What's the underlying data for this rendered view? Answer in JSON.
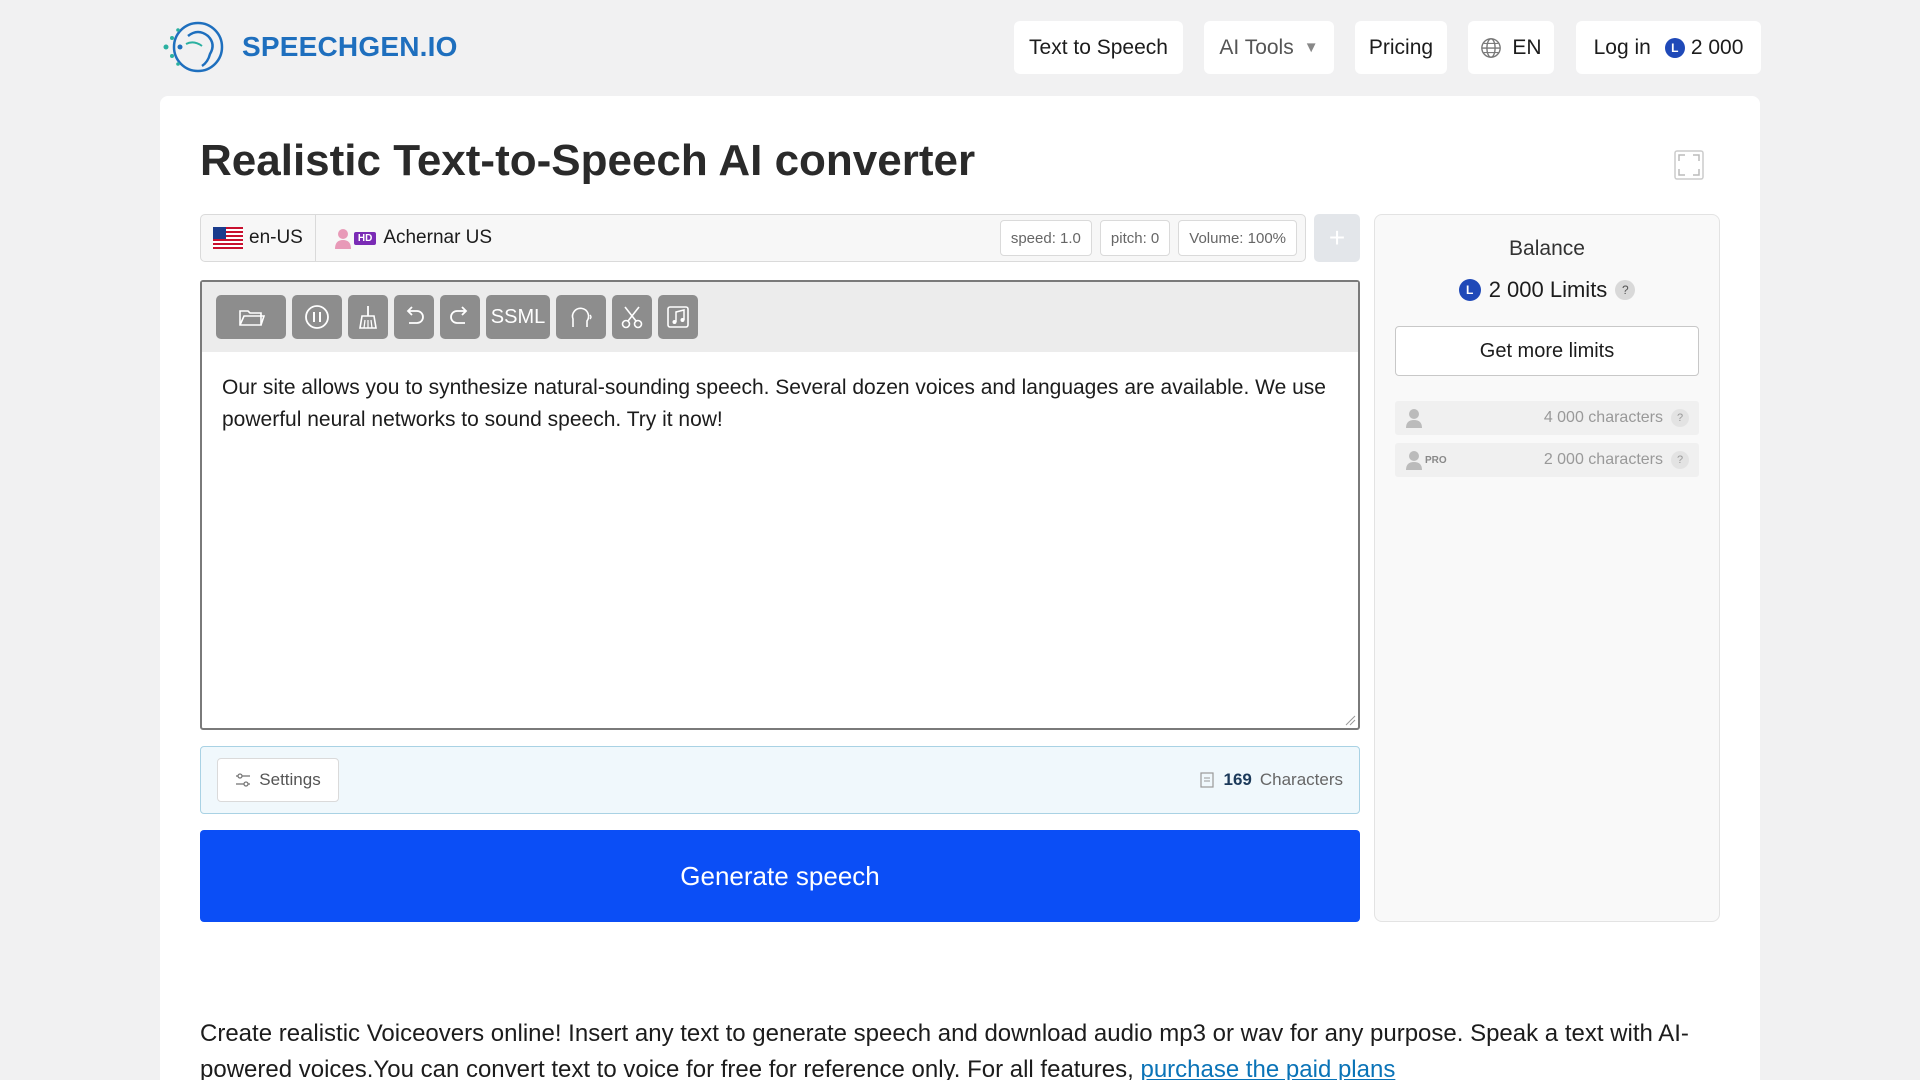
{
  "header": {
    "logo_text": "SPEECHGEN.IO",
    "nav": {
      "tts": "Text to Speech",
      "ai_tools": "AI Tools",
      "pricing": "Pricing",
      "lang": "EN",
      "login": "Log in",
      "coin_letter": "L",
      "balance": "2 000"
    }
  },
  "main": {
    "title": "Realistic Text-to-Speech AI converter",
    "voice_bar": {
      "lang": "en-US",
      "hd_badge": "HD",
      "voice": "Achernar US",
      "speed": "speed: 1.0",
      "pitch": "pitch: 0",
      "volume": "Volume: 100%",
      "add_label": "+"
    },
    "toolbar": {
      "ssml_label": "SSML",
      "icons": [
        "folder-icon",
        "pause-icon",
        "broom-icon",
        "undo-icon",
        "redo-icon",
        "ssml",
        "voice-head-icon",
        "scissors-icon",
        "music-note-icon"
      ]
    },
    "editor_text": "Our site allows you to synthesize natural-sounding speech. Several dozen voices and languages are available. We use powerful neural networks to sound speech. Try it now!",
    "settings_label": "Settings",
    "char_count": "169",
    "char_label": "Characters",
    "generate_label": "Generate speech"
  },
  "balance": {
    "title": "Balance",
    "coin_letter": "L",
    "amount": "2 000 Limits",
    "help": "?",
    "get_more": "Get more limits",
    "limits": [
      {
        "tier": "free",
        "value": "4 000 characters"
      },
      {
        "tier": "pro",
        "tag": "PRO",
        "value": "2 000 characters"
      }
    ]
  },
  "intro": {
    "text": "Create realistic Voiceovers online! Insert any text to generate speech and download audio mp3 or wav for any purpose. Speak a text with AI-powered voices.You can convert text to voice for free for reference only. For all features, ",
    "link": "purchase the paid plans"
  },
  "colors": {
    "accent": "#0b4ef6",
    "logo": "#1e6fbe",
    "coin": "#1f49b8",
    "link": "#0a73b7"
  }
}
